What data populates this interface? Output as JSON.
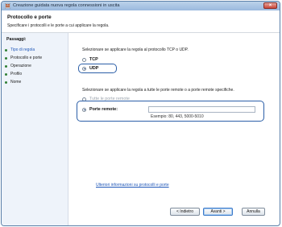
{
  "window": {
    "title": "Creazione guidata nuova regola connessioni in uscita",
    "close_glyph": "×"
  },
  "header": {
    "title": "Protocollo e porte",
    "subtitle": "Specificare i protocolli e le porte a cui applicare la regola."
  },
  "sidebar": {
    "title": "Passaggi:",
    "steps": [
      "Tipo di regola",
      "Protocollo e porte",
      "Operazione",
      "Profilo",
      "Nome"
    ]
  },
  "protocol": {
    "question": "Selezionare se applicare la regola al protocollo TCP o UDP.",
    "tcp_label": "TCP",
    "udp_label": "UDP",
    "selected": "UDP"
  },
  "ports": {
    "question": "Selezionare se applicare la regola a tutte le porte remote o a porte remote specifiche.",
    "all_label": "Tutte le porte remote",
    "specific_label": "Porte remote:",
    "specific_value": "",
    "example": "Esempio: 80, 443, 5000-5010",
    "selected": "specific"
  },
  "more_info_link": "Ulteriori informazioni su protocolli e porte",
  "buttons": {
    "back": "< Indietro",
    "next": "Avanti >",
    "cancel": "Annulla"
  },
  "colors": {
    "highlight": "#2c5fa8",
    "link": "#1f57b8",
    "step_dot": "#2f7f35"
  }
}
